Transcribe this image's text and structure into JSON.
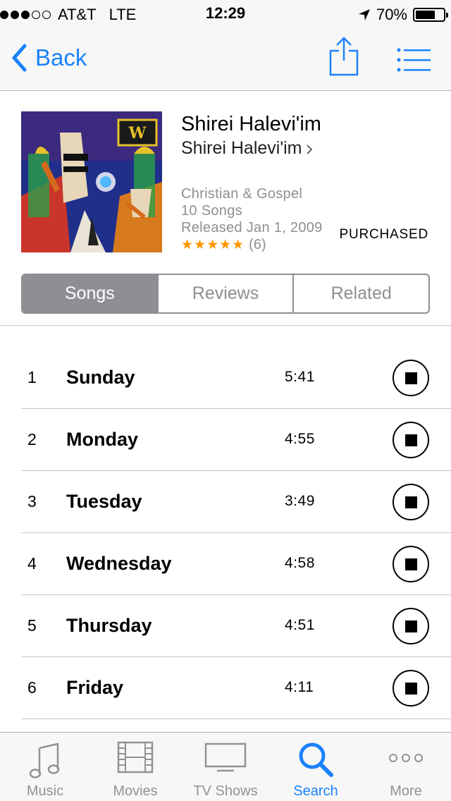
{
  "status_bar": {
    "carrier": "AT&T",
    "network": "LTE",
    "time": "12:29",
    "battery": "70%",
    "battery_level": 0.7
  },
  "nav": {
    "back_label": "Back"
  },
  "album": {
    "title": "Shirei Halevi'im",
    "artist": "Shirei Halevi'im",
    "genre": "Christian & Gospel",
    "song_count": "10 Songs",
    "released": "Released Jan 1, 2009",
    "stars": "★★★★★",
    "rating_count": "(6)",
    "status": "PURCHASED"
  },
  "segments": [
    {
      "label": "Songs",
      "active": true
    },
    {
      "label": "Reviews",
      "active": false
    },
    {
      "label": "Related",
      "active": false
    }
  ],
  "songs": [
    {
      "num": "1",
      "name": "Sunday",
      "duration": "5:41"
    },
    {
      "num": "2",
      "name": "Monday",
      "duration": "4:55"
    },
    {
      "num": "3",
      "name": "Tuesday",
      "duration": "3:49"
    },
    {
      "num": "4",
      "name": "Wednesday",
      "duration": "4:58"
    },
    {
      "num": "5",
      "name": "Thursday",
      "duration": "4:51"
    },
    {
      "num": "6",
      "name": "Friday",
      "duration": "4:11"
    }
  ],
  "tabs": [
    {
      "label": "Music",
      "icon": "music-note-icon"
    },
    {
      "label": "Movies",
      "icon": "film-strip-icon"
    },
    {
      "label": "TV Shows",
      "icon": "tv-icon"
    },
    {
      "label": "Search",
      "icon": "search-icon",
      "active": true
    },
    {
      "label": "More",
      "icon": "more-dots-icon"
    }
  ],
  "colors": {
    "accent": "#1a82fb",
    "star": "#ff9500",
    "secondary_text": "#8e8e93"
  }
}
